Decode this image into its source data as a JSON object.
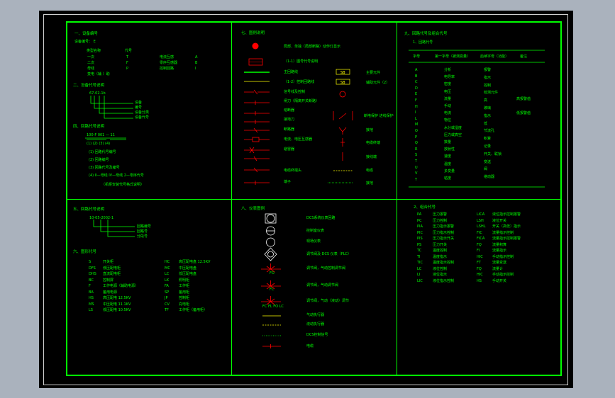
{
  "colors": {
    "background": "#000000",
    "frame": "#00ff00",
    "text": "#00ff00",
    "symbol_red": "#ff0000",
    "symbol_yellow": "#ffff00",
    "outer_bg": "#aab2bd"
  },
  "sec1": {
    "title": "一、设备编号",
    "line1": "设备编号：  E",
    "heads": [
      "类型名称",
      "代号"
    ],
    "rows": [
      [
        "一次",
        "T",
        "电流互感",
        "A"
      ],
      [
        "二次",
        "F",
        "零序互感器",
        "B"
      ],
      [
        "母线",
        "P",
        "控制回路",
        "I"
      ]
    ],
    "extra": "变电（辅 ）助"
  },
  "sec2": {
    "title": "二、设备代号说明",
    "code": "67-02-1b",
    "labels": [
      "设备",
      "编号",
      "设备分类",
      "设备代号"
    ]
  },
  "sec3": {
    "title": "四、回路代号说明",
    "code": "100-F 001 — 11",
    "sub": "(1)  (2)   (3)    (4)",
    "items": [
      "(1)   回路代号编号",
      "(2)   回路编号",
      "(3)   回路代号及编号",
      "(4)   II—母线  IV—母线  2—零序代号"
    ],
    "note": "（机柜安装代号格式说明）"
  },
  "sec4": {
    "title": "五、回路代号说明",
    "code": "10-05-2002-1",
    "labels": [
      "回路编号",
      "回路号",
      "分段号"
    ]
  },
  "sec5": {
    "title": "六、图形代号",
    "left": [
      [
        "S",
        "开关柜"
      ],
      [
        "DFS",
        "低压配电柜"
      ],
      [
        "DHS",
        "直流配电柜"
      ],
      [
        "BC",
        "控制屏"
      ],
      [
        "F",
        "工作电源（辅助电源）"
      ],
      [
        "BA",
        "备用电源"
      ],
      [
        "HS",
        "高压配电 12.5KV"
      ],
      [
        "MS",
        "中压配电 11.1KV"
      ],
      [
        "LS",
        "低压配电 10.5KV"
      ]
    ],
    "right": [
      [
        "HC",
        "高压配电盘 12.5KV"
      ],
      [
        "MC",
        "中压配电盘"
      ],
      [
        "LC",
        "低压配电盘"
      ],
      [
        "LK",
        "照明柜"
      ],
      [
        "FA",
        "工作柜"
      ],
      [
        "SP",
        "备用柜"
      ],
      [
        "JP",
        "控制柜"
      ],
      [
        "CV",
        "充电柜"
      ],
      [
        "TF",
        "工作柜（备用柜）"
      ]
    ]
  },
  "sec6": {
    "title": "七、图例说明",
    "rows": [
      "局部、单独（局部断路）动作灯显示",
      "（1-1）图号代号说明",
      "主回路线",
      "（1-2）控制回路线",
      "信号线及控制",
      "闸刀（隔离开关断路）",
      "熔断器",
      "接地刀",
      "断路器",
      "电流、电压互感器",
      "避雷器",
      "电缆终端头",
      "端子"
    ],
    "right": [
      "主要元件",
      "辅助元件（2）",
      "断电保护  进线保护",
      "接地",
      "电缆终端",
      "接线端",
      "电缆",
      "接地"
    ],
    "box1": "SB",
    "box2": "SB"
  },
  "sec7": {
    "title": "八、仪表图例",
    "rows": [
      "DCS系统仪表回路",
      "控制室仪表",
      "现场仪表",
      "调节阀及 DCS 仪表（PLC）",
      "调节阀，气动控制调节阀",
      "调节阀，气动调节阀",
      "调节阀，气动（液动）调节",
      "气动执行器",
      "液动执行器",
      "DCS控制信号",
      "电缆"
    ],
    "labels": [
      "FO",
      "FC",
      "FC FL FO LC"
    ]
  },
  "sec8": {
    "title": "九、回路代号及组合代号",
    "sub": "1、回路代号",
    "heads": [
      "字母",
      "第一字母（被测变量）",
      "后续字母（功能）",
      "备注"
    ],
    "letters": [
      "A",
      "B",
      "C",
      "D",
      "E",
      "F",
      "H",
      "I",
      "L",
      "M",
      "O",
      "P",
      "Q",
      "R",
      "S",
      "T",
      "U",
      "V",
      "Y"
    ],
    "col2": [
      "分析",
      "电导率",
      "密度",
      "电压",
      "流量",
      "手动",
      "电流",
      "物位",
      "水分或湿度",
      "压力或真空",
      "数量",
      "放射性",
      "速度",
      "温度",
      "多变量",
      "粘度"
    ],
    "col3": [
      "报警",
      "指示",
      "控制",
      "检测元件",
      "高",
      "玻璃",
      "指示",
      "低",
      "节流孔",
      "积算",
      "记录",
      "开关、联锁",
      "变送",
      "阀",
      "继动器"
    ],
    "notes": [
      "高报警值",
      "低报警值"
    ]
  },
  "sec9": {
    "title": "2、组合代号",
    "left": [
      [
        "PA",
        "压力报警"
      ],
      [
        "PC",
        "压力控制"
      ],
      [
        "PIA",
        "压力指示报警"
      ],
      [
        "PIC",
        "压力指示控制"
      ],
      [
        "PIS",
        "压力指示开关"
      ],
      [
        "PS",
        "压力开关"
      ],
      [
        "TC",
        "温度控制"
      ],
      [
        "TI",
        "温度指示"
      ],
      [
        "TIC",
        "温度指示控制"
      ],
      [
        "LC",
        "液位控制"
      ],
      [
        "LI",
        "液位指示"
      ],
      [
        "LIC",
        "液位指示控制"
      ]
    ],
    "right": [
      [
        "LICA",
        "液位指示控制报警"
      ],
      [
        "LSH",
        "液位开关"
      ],
      [
        "LSHL",
        "开关（高低）指示"
      ],
      [
        "FIC",
        "流量指示控制"
      ],
      [
        "FICA",
        "流量指示控制报警"
      ],
      [
        "FQ",
        "流量积算"
      ],
      [
        "FI",
        "流量指示"
      ],
      [
        "HIC",
        "手动指示控制"
      ],
      [
        "FT",
        "流量变送"
      ],
      [
        "FQ",
        "流量计"
      ],
      [
        "HIC",
        "手动指示控制"
      ],
      [
        "HS",
        "手动开关"
      ]
    ]
  }
}
